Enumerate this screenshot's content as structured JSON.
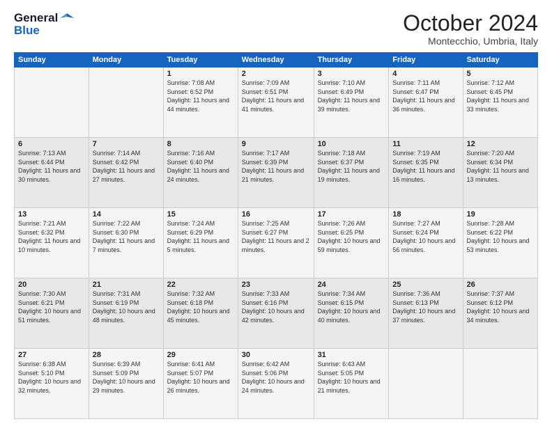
{
  "header": {
    "logo_general": "General",
    "logo_blue": "Blue",
    "month_title": "October 2024",
    "location": "Montecchio, Umbria, Italy"
  },
  "weekdays": [
    "Sunday",
    "Monday",
    "Tuesday",
    "Wednesday",
    "Thursday",
    "Friday",
    "Saturday"
  ],
  "weeks": [
    [
      {
        "day": "",
        "sunrise": "",
        "sunset": "",
        "daylight": ""
      },
      {
        "day": "",
        "sunrise": "",
        "sunset": "",
        "daylight": ""
      },
      {
        "day": "1",
        "sunrise": "Sunrise: 7:08 AM",
        "sunset": "Sunset: 6:52 PM",
        "daylight": "Daylight: 11 hours and 44 minutes."
      },
      {
        "day": "2",
        "sunrise": "Sunrise: 7:09 AM",
        "sunset": "Sunset: 6:51 PM",
        "daylight": "Daylight: 11 hours and 41 minutes."
      },
      {
        "day": "3",
        "sunrise": "Sunrise: 7:10 AM",
        "sunset": "Sunset: 6:49 PM",
        "daylight": "Daylight: 11 hours and 39 minutes."
      },
      {
        "day": "4",
        "sunrise": "Sunrise: 7:11 AM",
        "sunset": "Sunset: 6:47 PM",
        "daylight": "Daylight: 11 hours and 36 minutes."
      },
      {
        "day": "5",
        "sunrise": "Sunrise: 7:12 AM",
        "sunset": "Sunset: 6:45 PM",
        "daylight": "Daylight: 11 hours and 33 minutes."
      }
    ],
    [
      {
        "day": "6",
        "sunrise": "Sunrise: 7:13 AM",
        "sunset": "Sunset: 6:44 PM",
        "daylight": "Daylight: 11 hours and 30 minutes."
      },
      {
        "day": "7",
        "sunrise": "Sunrise: 7:14 AM",
        "sunset": "Sunset: 6:42 PM",
        "daylight": "Daylight: 11 hours and 27 minutes."
      },
      {
        "day": "8",
        "sunrise": "Sunrise: 7:16 AM",
        "sunset": "Sunset: 6:40 PM",
        "daylight": "Daylight: 11 hours and 24 minutes."
      },
      {
        "day": "9",
        "sunrise": "Sunrise: 7:17 AM",
        "sunset": "Sunset: 6:39 PM",
        "daylight": "Daylight: 11 hours and 21 minutes."
      },
      {
        "day": "10",
        "sunrise": "Sunrise: 7:18 AM",
        "sunset": "Sunset: 6:37 PM",
        "daylight": "Daylight: 11 hours and 19 minutes."
      },
      {
        "day": "11",
        "sunrise": "Sunrise: 7:19 AM",
        "sunset": "Sunset: 6:35 PM",
        "daylight": "Daylight: 11 hours and 16 minutes."
      },
      {
        "day": "12",
        "sunrise": "Sunrise: 7:20 AM",
        "sunset": "Sunset: 6:34 PM",
        "daylight": "Daylight: 11 hours and 13 minutes."
      }
    ],
    [
      {
        "day": "13",
        "sunrise": "Sunrise: 7:21 AM",
        "sunset": "Sunset: 6:32 PM",
        "daylight": "Daylight: 11 hours and 10 minutes."
      },
      {
        "day": "14",
        "sunrise": "Sunrise: 7:22 AM",
        "sunset": "Sunset: 6:30 PM",
        "daylight": "Daylight: 11 hours and 7 minutes."
      },
      {
        "day": "15",
        "sunrise": "Sunrise: 7:24 AM",
        "sunset": "Sunset: 6:29 PM",
        "daylight": "Daylight: 11 hours and 5 minutes."
      },
      {
        "day": "16",
        "sunrise": "Sunrise: 7:25 AM",
        "sunset": "Sunset: 6:27 PM",
        "daylight": "Daylight: 11 hours and 2 minutes."
      },
      {
        "day": "17",
        "sunrise": "Sunrise: 7:26 AM",
        "sunset": "Sunset: 6:25 PM",
        "daylight": "Daylight: 10 hours and 59 minutes."
      },
      {
        "day": "18",
        "sunrise": "Sunrise: 7:27 AM",
        "sunset": "Sunset: 6:24 PM",
        "daylight": "Daylight: 10 hours and 56 minutes."
      },
      {
        "day": "19",
        "sunrise": "Sunrise: 7:28 AM",
        "sunset": "Sunset: 6:22 PM",
        "daylight": "Daylight: 10 hours and 53 minutes."
      }
    ],
    [
      {
        "day": "20",
        "sunrise": "Sunrise: 7:30 AM",
        "sunset": "Sunset: 6:21 PM",
        "daylight": "Daylight: 10 hours and 51 minutes."
      },
      {
        "day": "21",
        "sunrise": "Sunrise: 7:31 AM",
        "sunset": "Sunset: 6:19 PM",
        "daylight": "Daylight: 10 hours and 48 minutes."
      },
      {
        "day": "22",
        "sunrise": "Sunrise: 7:32 AM",
        "sunset": "Sunset: 6:18 PM",
        "daylight": "Daylight: 10 hours and 45 minutes."
      },
      {
        "day": "23",
        "sunrise": "Sunrise: 7:33 AM",
        "sunset": "Sunset: 6:16 PM",
        "daylight": "Daylight: 10 hours and 42 minutes."
      },
      {
        "day": "24",
        "sunrise": "Sunrise: 7:34 AM",
        "sunset": "Sunset: 6:15 PM",
        "daylight": "Daylight: 10 hours and 40 minutes."
      },
      {
        "day": "25",
        "sunrise": "Sunrise: 7:36 AM",
        "sunset": "Sunset: 6:13 PM",
        "daylight": "Daylight: 10 hours and 37 minutes."
      },
      {
        "day": "26",
        "sunrise": "Sunrise: 7:37 AM",
        "sunset": "Sunset: 6:12 PM",
        "daylight": "Daylight: 10 hours and 34 minutes."
      }
    ],
    [
      {
        "day": "27",
        "sunrise": "Sunrise: 6:38 AM",
        "sunset": "Sunset: 5:10 PM",
        "daylight": "Daylight: 10 hours and 32 minutes."
      },
      {
        "day": "28",
        "sunrise": "Sunrise: 6:39 AM",
        "sunset": "Sunset: 5:09 PM",
        "daylight": "Daylight: 10 hours and 29 minutes."
      },
      {
        "day": "29",
        "sunrise": "Sunrise: 6:41 AM",
        "sunset": "Sunset: 5:07 PM",
        "daylight": "Daylight: 10 hours and 26 minutes."
      },
      {
        "day": "30",
        "sunrise": "Sunrise: 6:42 AM",
        "sunset": "Sunset: 5:06 PM",
        "daylight": "Daylight: 10 hours and 24 minutes."
      },
      {
        "day": "31",
        "sunrise": "Sunrise: 6:43 AM",
        "sunset": "Sunset: 5:05 PM",
        "daylight": "Daylight: 10 hours and 21 minutes."
      },
      {
        "day": "",
        "sunrise": "",
        "sunset": "",
        "daylight": ""
      },
      {
        "day": "",
        "sunrise": "",
        "sunset": "",
        "daylight": ""
      }
    ]
  ]
}
